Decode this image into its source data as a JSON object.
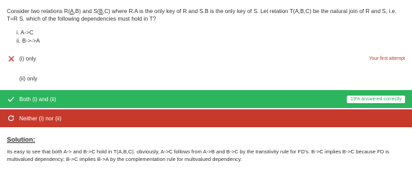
{
  "question": {
    "part1": "Consider two relations R(",
    "part2": "A",
    "part3": ",B) and S(",
    "part4": "B",
    "part5": ",C) where R.A is the only key of R and S.B is the only key of S. Let relation T(A,B,C) be the natural join of R and S, i.e. T=R S. which of the following dependencies must hold in T?",
    "conditions": [
      "i. A->C",
      "ii. B->->A"
    ]
  },
  "options": [
    {
      "label": "(i) only",
      "tag": "Your first attempt",
      "icon": "cross-icon",
      "state": "wrong"
    },
    {
      "label": "(ii) only",
      "tag": "",
      "icon": "",
      "state": "neutral"
    },
    {
      "label": "Both (i) and (ii)",
      "tag": "19% answered correctly",
      "icon": "check-icon",
      "state": "correct"
    },
    {
      "label": "Neither (i) nor (ii)",
      "tag": "",
      "icon": "refresh-icon",
      "state": "incorrect"
    }
  ],
  "solution": {
    "heading": "Solution:",
    "text": "Its easy to see that both A-> and B->C hold in T(A,B,C). obviously, A->C follows from A->B and B->C by the transitivity rule for FD's. B->C implies B->C because FD is multivalued dependency; B->C implies B->A by the complementation rule for multivalued dependency."
  },
  "colors": {
    "correct": "#2bb55c",
    "incorrect": "#c73a2b",
    "text": "#333333",
    "wrong_mark": "#c73a2b"
  }
}
